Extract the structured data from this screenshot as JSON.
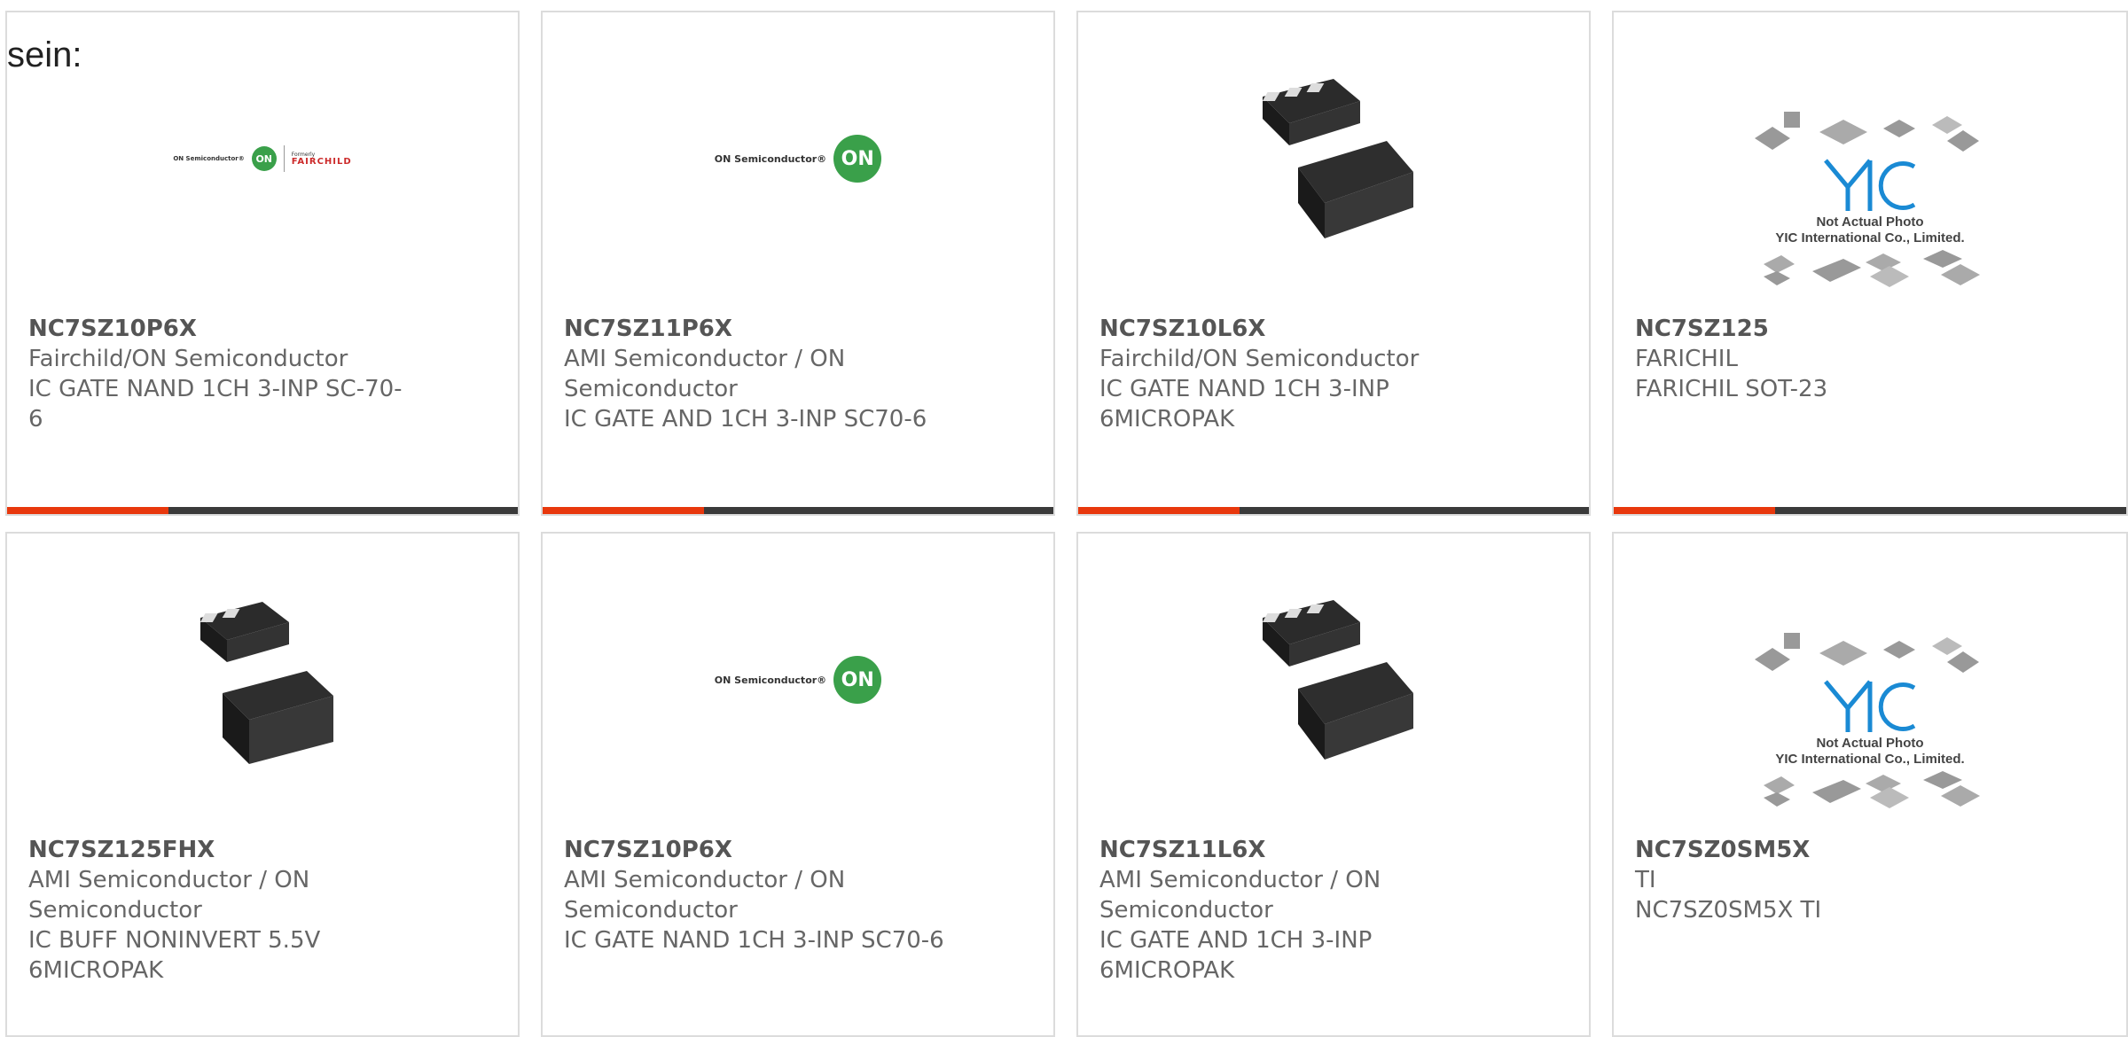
{
  "page": {
    "heading_fragment": "sein:"
  },
  "products": [
    {
      "part": "NC7SZ10P6X",
      "lines": [
        "Fairchild/ON Semiconductor",
        "IC GATE NAND 1CH 3-INP SC-70-",
        "6"
      ],
      "image": "fairchild-on-logo"
    },
    {
      "part": "NC7SZ11P6X",
      "lines": [
        "AMI Semiconductor / ON",
        "Semiconductor",
        "IC GATE AND 1CH 3-INP SC70-6"
      ],
      "image": "on-semiconductor-logo"
    },
    {
      "part": "NC7SZ10L6X",
      "lines": [
        "Fairchild/ON Semiconductor",
        "IC GATE NAND 1CH 3-INP",
        "6MICROPAK"
      ],
      "image": "micropak-chip-photo"
    },
    {
      "part": "NC7SZ125",
      "lines": [
        "FARICHIL",
        "FARICHIL SOT-23"
      ],
      "image": "yic-not-actual-photo"
    },
    {
      "part": "NC7SZ125FHX",
      "lines": [
        "AMI Semiconductor / ON",
        "Semiconductor",
        "IC BUFF NONINVERT 5.5V",
        "6MICROPAK"
      ],
      "image": "micropak-chip-photo"
    },
    {
      "part": "NC7SZ10P6X",
      "lines": [
        "AMI Semiconductor / ON",
        "Semiconductor",
        "IC GATE NAND 1CH 3-INP SC70-6"
      ],
      "image": "on-semiconductor-logo"
    },
    {
      "part": "NC7SZ11L6X",
      "lines": [
        "AMI Semiconductor / ON",
        "Semiconductor",
        "IC GATE AND 1CH 3-INP",
        "6MICROPAK"
      ],
      "image": "micropak-chip-photo"
    },
    {
      "part": "NC7SZ0SM5X",
      "lines": [
        "TI",
        "NC7SZ0SM5X TI"
      ],
      "image": "yic-not-actual-photo"
    }
  ],
  "logos": {
    "on_word": "ON Semiconductor®",
    "on_mark": "ON",
    "fairchild_formerly": "Formerly",
    "fairchild_name": "FAIRCHILD",
    "yic_lines": [
      "Not Actual Photo",
      "YIC International Co., Limited."
    ]
  },
  "colors": {
    "accent": "#e8380d",
    "bar": "#3a3a3a",
    "on_green": "#3aa04a"
  }
}
